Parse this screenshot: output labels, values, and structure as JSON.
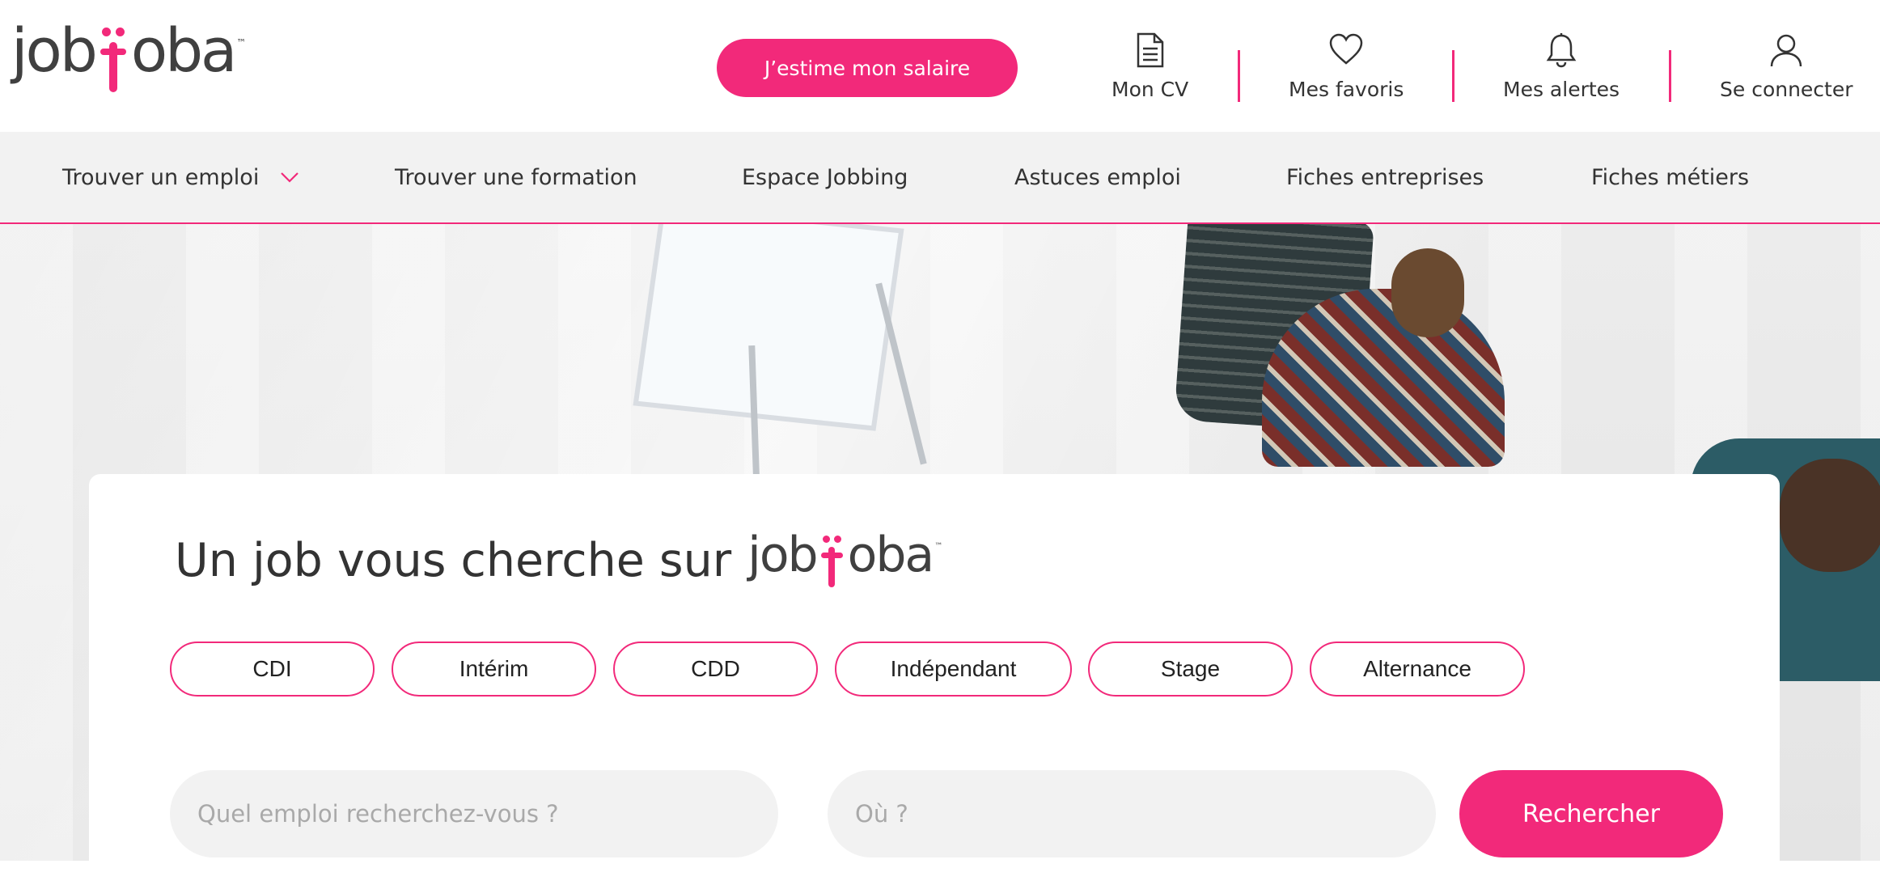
{
  "brand": {
    "logo_left": "job",
    "logo_right": "oba",
    "logo_tm": "™",
    "accent_color": "#f2297a"
  },
  "header": {
    "salary_button": "J’estime mon salaire",
    "items": [
      {
        "label": "Mon CV",
        "icon": "document-icon"
      },
      {
        "label": "Mes favoris",
        "icon": "heart-icon"
      },
      {
        "label": "Mes alertes",
        "icon": "bell-icon"
      },
      {
        "label": "Se connecter",
        "icon": "user-icon"
      }
    ]
  },
  "nav": {
    "items": [
      {
        "label": "Trouver un emploi",
        "has_dropdown": true
      },
      {
        "label": "Trouver une formation"
      },
      {
        "label": "Espace Jobbing"
      },
      {
        "label": "Astuces emploi"
      },
      {
        "label": "Fiches entreprises"
      },
      {
        "label": "Fiches métiers"
      }
    ]
  },
  "search": {
    "title": "Un job vous cherche sur",
    "contract_types": [
      "CDI",
      "Intérim",
      "CDD",
      "Indépendant",
      "Stage",
      "Alternance"
    ],
    "what_placeholder": "Quel emploi recherchez-vous ?",
    "where_placeholder": "Où ?",
    "submit_label": "Rechercher"
  }
}
